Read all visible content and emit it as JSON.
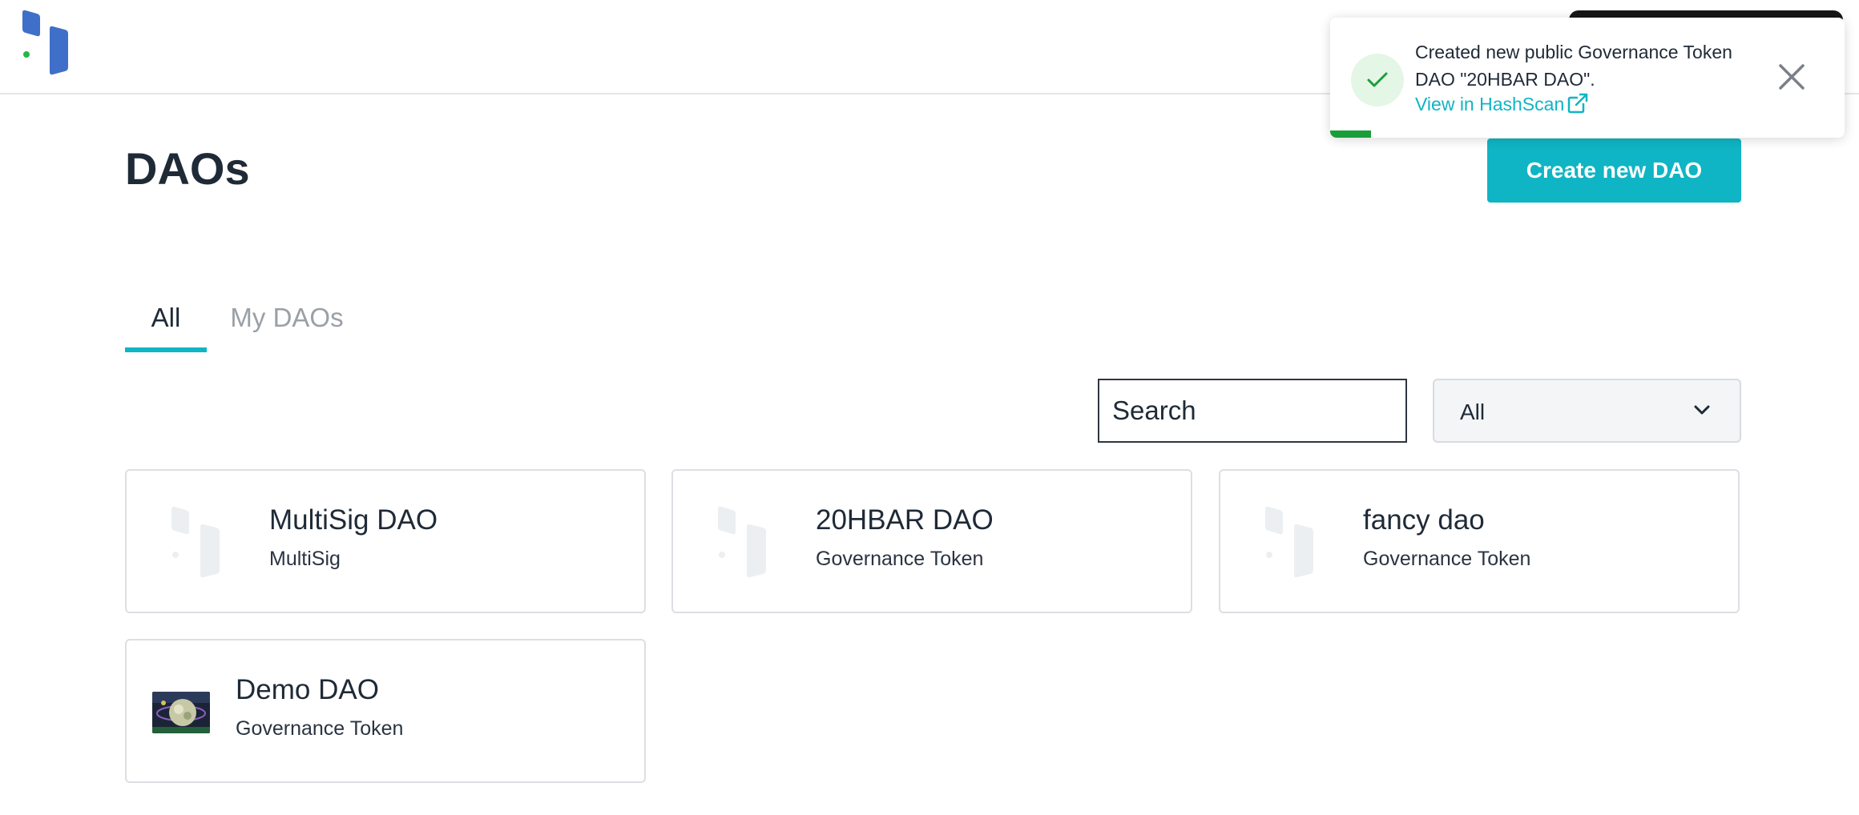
{
  "page": {
    "title": "DAOs"
  },
  "actions": {
    "create_label": "Create new DAO"
  },
  "tabs": [
    {
      "label": "All",
      "active": true
    },
    {
      "label": "My DAOs",
      "active": false
    }
  ],
  "filters": {
    "search_placeholder": "Search",
    "type_selected": "All"
  },
  "daos": [
    {
      "name": "MultiSig DAO",
      "type": "MultiSig",
      "image": "placeholder-logo"
    },
    {
      "name": "20HBAR DAO",
      "type": "Governance Token",
      "image": "placeholder-logo"
    },
    {
      "name": "fancy dao",
      "type": "Governance Token",
      "image": "placeholder-logo"
    },
    {
      "name": "Demo DAO",
      "type": "Governance Token",
      "image": "dao-image"
    }
  ],
  "toast": {
    "message": "Created new public Governance Token DAO \"20HBAR DAO\".",
    "link_label": "View in HashScan",
    "progress": 0.08,
    "icon": "check-icon"
  },
  "colors": {
    "accent": "#0fb5c4",
    "success": "#1a9e3a",
    "brand_blue": "#3f6fc9"
  }
}
